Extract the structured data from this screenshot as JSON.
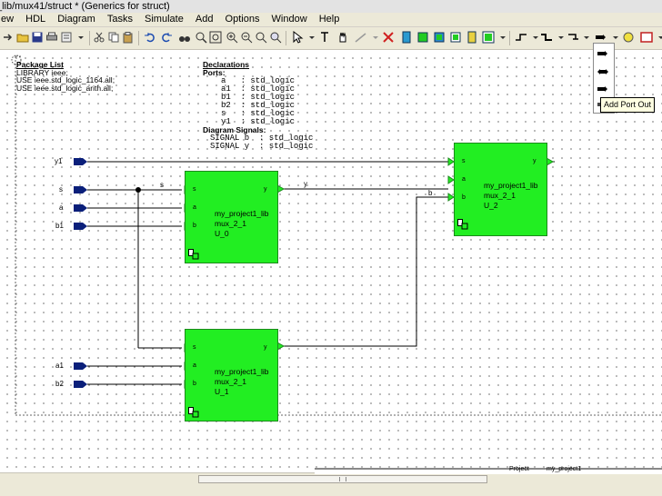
{
  "window": {
    "title": "_lib/mux41/struct * (Generics for struct)"
  },
  "menu": [
    "ew",
    "HDL",
    "Diagram",
    "Tasks",
    "Simulate",
    "Add",
    "Options",
    "Window",
    "Help"
  ],
  "package_list": {
    "header": "Package List",
    "lines": [
      "LIBRARY ieee;",
      "USE ieee.std_logic_1164.all;",
      "USE ieee.std_logic_arith.all;"
    ]
  },
  "declarations": {
    "header": "Declarations",
    "ports_header": "Ports:",
    "ports": [
      "a   : std_logic",
      "a1  : std_logic",
      "b1  : std_logic",
      "b2  : std_logic",
      "s   : std_logic",
      "y1  : std_logic"
    ],
    "signals_header": "Diagram Signals:",
    "signals": [
      "SIGNAL b  : std_logic",
      "SIGNAL y  : std_logic"
    ]
  },
  "ports": {
    "y1": "y1",
    "s": "s",
    "a": "a",
    "b1": "b1",
    "a1": "a1",
    "b2": "b2"
  },
  "wires": {
    "s": "s",
    "y": "y",
    "b": "b"
  },
  "blocks": [
    {
      "lib": "my_project1_lib",
      "cell": "mux_2_1",
      "inst": "U_0",
      "pins": {
        "s": "s",
        "a": "a",
        "b": "b",
        "y": "y"
      }
    },
    {
      "lib": "my_project1_lib",
      "cell": "mux_2_1",
      "inst": "U_1",
      "pins": {
        "s": "s",
        "a": "a",
        "b": "b",
        "y": "y"
      }
    },
    {
      "lib": "my_project1_lib",
      "cell": "mux_2_1",
      "inst": "U_2",
      "pins": {
        "s": "s",
        "a": "a",
        "b": "b",
        "y": "y"
      }
    }
  ],
  "tooltip": "Add Port Out",
  "bottom_panel": {
    "label": "Project",
    "value": "my_project1"
  },
  "colors": {
    "block": "#22ee22",
    "port": "#0a1f7a",
    "wire": "#000000"
  }
}
